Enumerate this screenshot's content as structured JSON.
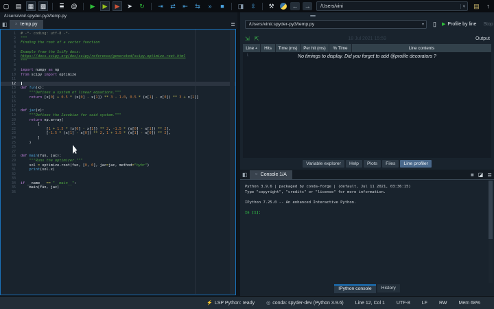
{
  "colors": {
    "accent_blue": "#1a72bb",
    "run_green": "#2fbf3a",
    "debug_blue": "#4aa3e0",
    "selected_tab_blue": "#49688b",
    "editor_bg": "#19232d",
    "string_green": "#4fa63f",
    "keyword_magenta": "#bd7fd8"
  },
  "toolbar": {
    "main_icons": [
      {
        "name": "new-file-icon",
        "glyph": "▢",
        "color": "#e8edf2"
      },
      {
        "name": "open-file-icon",
        "glyph": "▤",
        "color": "#e8edf2"
      },
      {
        "name": "save-file-icon",
        "glyph": "▦",
        "color": "#e8edf2",
        "boxed": true
      },
      {
        "name": "save-all-icon",
        "glyph": "▩",
        "color": "#e8edf2",
        "boxed": true
      },
      {
        "sep": true
      },
      {
        "name": "file-switcher-icon",
        "glyph": "≣",
        "color": "#e8edf2"
      },
      {
        "name": "find-symbols-icon",
        "glyph": "@",
        "color": "#e8edf2"
      },
      {
        "sep": true
      },
      {
        "name": "run-file-icon",
        "glyph": "▶",
        "color": "#2fbf3a"
      },
      {
        "name": "run-cell-icon",
        "glyph": "▶",
        "color": "#9ac31c",
        "boxed": true
      },
      {
        "name": "run-cell-advance-icon",
        "glyph": "▶",
        "color": "#d05438",
        "boxed": true
      },
      {
        "name": "run-selection-icon",
        "glyph": "➤",
        "color": "#dfe6ec"
      },
      {
        "name": "rerun-cell-icon",
        "glyph": "↻",
        "color": "#2fbf3a"
      },
      {
        "sep": true
      },
      {
        "name": "debug-file-icon",
        "glyph": "⇥",
        "color": "#4aa3e0"
      },
      {
        "name": "step-over-icon",
        "glyph": "⇄",
        "color": "#4aa3e0"
      },
      {
        "name": "step-into-icon",
        "glyph": "⇤",
        "color": "#4aa3e0"
      },
      {
        "name": "step-return-icon",
        "glyph": "⇆",
        "color": "#4aa3e0"
      },
      {
        "name": "continue-icon",
        "glyph": "»",
        "color": "#4aa3e0"
      },
      {
        "name": "stop-debug-icon",
        "glyph": "■",
        "color": "#4aa3e0"
      },
      {
        "sep": true
      },
      {
        "name": "panes-icon",
        "glyph": "◨",
        "color": "#8496a8"
      },
      {
        "name": "fullscreen-icon",
        "glyph": "⇳",
        "color": "#4aa3e0"
      }
    ],
    "back_glyph": "←",
    "forward_glyph": "→",
    "wrench_glyph": "⚒",
    "cwd_value": "/Users/vini",
    "open_dir_glyph": "▤",
    "parent_dir_glyph": "↑"
  },
  "editor": {
    "breadcrumb": "/Users/vini/.spyder-py3/temp.py",
    "tab_label": "temp.py",
    "close_glyph": "×",
    "options_glyph": "≣",
    "browse_tabs_glyph": "◧",
    "current_line": 12,
    "lines": [
      [
        [
          "c",
          "# -*- coding: utf-8 -*-"
        ]
      ],
      [
        [
          "s",
          "\"\"\""
        ]
      ],
      [
        [
          "s",
          "Finding the root of a vector function"
        ]
      ],
      [],
      [
        [
          "s",
          "Example from the SciPy docs:"
        ]
      ],
      [
        [
          "u",
          "https://docs.scipy.org/doc/scipy/reference/generated/scipy.optimize.root.html"
        ]
      ],
      [
        [
          "s",
          "\"\"\""
        ]
      ],
      [],
      [
        [
          "k",
          "import"
        ],
        [
          "t",
          " numpy "
        ],
        [
          "k",
          "as"
        ],
        [
          "t",
          " np"
        ]
      ],
      [
        [
          "k",
          "from"
        ],
        [
          "t",
          " scipy "
        ],
        [
          "k",
          "import"
        ],
        [
          "t",
          " optimize"
        ]
      ],
      [],
      [],
      [
        [
          "k",
          "def"
        ],
        [
          "t",
          " "
        ],
        [
          "f",
          "fun"
        ],
        [
          "t",
          "(x):"
        ]
      ],
      [
        [
          "s",
          "    \"\"\"Defines a system of linear equations.\"\"\""
        ]
      ],
      [
        [
          "k",
          "    return"
        ],
        [
          "t",
          " [x["
        ],
        [
          "n",
          "0"
        ],
        [
          "t",
          "] "
        ],
        [
          "o",
          "+"
        ],
        [
          "t",
          " "
        ],
        [
          "n",
          "0.5"
        ],
        [
          "t",
          " "
        ],
        [
          "o",
          "*"
        ],
        [
          "t",
          " (x["
        ],
        [
          "n",
          "0"
        ],
        [
          "t",
          "] "
        ],
        [
          "o",
          "-"
        ],
        [
          "t",
          " x["
        ],
        [
          "n",
          "1"
        ],
        [
          "t",
          "]) "
        ],
        [
          "o",
          "**"
        ],
        [
          "t",
          " "
        ],
        [
          "n",
          "3"
        ],
        [
          "t",
          " "
        ],
        [
          "o",
          "-"
        ],
        [
          "t",
          " "
        ],
        [
          "n",
          "1.0"
        ],
        [
          "t",
          ", "
        ],
        [
          "n",
          "0.5"
        ],
        [
          "t",
          " "
        ],
        [
          "o",
          "*"
        ],
        [
          "t",
          " (x["
        ],
        [
          "n",
          "1"
        ],
        [
          "t",
          "] "
        ],
        [
          "o",
          "-"
        ],
        [
          "t",
          " x["
        ],
        [
          "n",
          "0"
        ],
        [
          "t",
          "]) "
        ],
        [
          "o",
          "**"
        ],
        [
          "t",
          " "
        ],
        [
          "n",
          "3"
        ],
        [
          "t",
          " "
        ],
        [
          "o",
          "+"
        ],
        [
          "t",
          " x["
        ],
        [
          "n",
          "1"
        ],
        [
          "t",
          "]]"
        ]
      ],
      [],
      [],
      [
        [
          "k",
          "def"
        ],
        [
          "t",
          " "
        ],
        [
          "f",
          "jac"
        ],
        [
          "t",
          "(x):"
        ]
      ],
      [
        [
          "s",
          "    \"\"\"Defines the Jacobian for said system.\"\"\""
        ]
      ],
      [
        [
          "k",
          "    return"
        ],
        [
          "t",
          " np.array("
        ]
      ],
      [
        [
          "t",
          "        ["
        ]
      ],
      [
        [
          "t",
          "            ["
        ],
        [
          "n",
          "1"
        ],
        [
          "t",
          " "
        ],
        [
          "o",
          "+"
        ],
        [
          "t",
          " "
        ],
        [
          "n",
          "1.5"
        ],
        [
          "t",
          " "
        ],
        [
          "o",
          "*"
        ],
        [
          "t",
          " (x["
        ],
        [
          "n",
          "0"
        ],
        [
          "t",
          "] "
        ],
        [
          "o",
          "-"
        ],
        [
          "t",
          " x["
        ],
        [
          "n",
          "1"
        ],
        [
          "t",
          "]) "
        ],
        [
          "o",
          "**"
        ],
        [
          "t",
          " "
        ],
        [
          "n",
          "2"
        ],
        [
          "t",
          ", "
        ],
        [
          "o",
          "-"
        ],
        [
          "n",
          "1.5"
        ],
        [
          "t",
          " "
        ],
        [
          "o",
          "*"
        ],
        [
          "t",
          " (x["
        ],
        [
          "n",
          "0"
        ],
        [
          "t",
          "] "
        ],
        [
          "o",
          "-"
        ],
        [
          "t",
          " x["
        ],
        [
          "n",
          "1"
        ],
        [
          "t",
          "]) "
        ],
        [
          "o",
          "**"
        ],
        [
          "t",
          " "
        ],
        [
          "n",
          "2"
        ],
        [
          "t",
          "],"
        ]
      ],
      [
        [
          "t",
          "            ["
        ],
        [
          "o",
          "-"
        ],
        [
          "n",
          "1.5"
        ],
        [
          "t",
          " "
        ],
        [
          "o",
          "*"
        ],
        [
          "t",
          " (x["
        ],
        [
          "n",
          "1"
        ],
        [
          "t",
          "] "
        ],
        [
          "o",
          "-"
        ],
        [
          "t",
          " x["
        ],
        [
          "n",
          "0"
        ],
        [
          "t",
          "]) "
        ],
        [
          "o",
          "**"
        ],
        [
          "t",
          " "
        ],
        [
          "n",
          "2"
        ],
        [
          "t",
          ", "
        ],
        [
          "n",
          "1"
        ],
        [
          "t",
          " "
        ],
        [
          "o",
          "+"
        ],
        [
          "t",
          " "
        ],
        [
          "n",
          "1.5"
        ],
        [
          "t",
          " "
        ],
        [
          "o",
          "*"
        ],
        [
          "t",
          " (x["
        ],
        [
          "n",
          "1"
        ],
        [
          "t",
          "] "
        ],
        [
          "o",
          "-"
        ],
        [
          "t",
          " x["
        ],
        [
          "n",
          "0"
        ],
        [
          "t",
          "]) "
        ],
        [
          "o",
          "**"
        ],
        [
          "t",
          " "
        ],
        [
          "n",
          "2"
        ],
        [
          "t",
          "],"
        ]
      ],
      [
        [
          "t",
          "        ]"
        ]
      ],
      [
        [
          "t",
          "    )"
        ]
      ],
      [],
      [],
      [
        [
          "k",
          "def"
        ],
        [
          "t",
          " "
        ],
        [
          "f",
          "main"
        ],
        [
          "t",
          "(fun, jac):"
        ]
      ],
      [
        [
          "s",
          "    \"\"\"Runs the optimizer.\"\"\""
        ]
      ],
      [
        [
          "t",
          "    sol "
        ],
        [
          "o",
          "="
        ],
        [
          "t",
          " optimize.root(fun, ["
        ],
        [
          "n",
          "0"
        ],
        [
          "t",
          ", "
        ],
        [
          "n",
          "0"
        ],
        [
          "t",
          "], jac"
        ],
        [
          "o",
          "="
        ],
        [
          "t",
          "jac, method"
        ],
        [
          "o",
          "="
        ],
        [
          "s",
          "\"hybr\""
        ],
        [
          "t",
          ")"
        ]
      ],
      [
        [
          "t",
          "    "
        ],
        [
          "f",
          "print"
        ],
        [
          "t",
          "(sol.x)"
        ]
      ],
      [],
      [],
      [
        [
          "k",
          "if"
        ],
        [
          "t",
          " __name__ "
        ],
        [
          "o",
          "=="
        ],
        [
          "t",
          " "
        ],
        [
          "s",
          "\"__main__\""
        ],
        [
          "t",
          ":"
        ]
      ],
      [
        [
          "t",
          "    main(fun, jac)"
        ]
      ],
      []
    ]
  },
  "profiler": {
    "file_value": "/Users/vini/.spyder-py3/temp.py",
    "doc_glyph": "▯",
    "play_glyph": "▶",
    "profile_button": "Profile by line",
    "stop_button": "Stop",
    "collapse_glyph": "⇲",
    "expand_glyph": "⇱",
    "timestamp": "18 Jul 2021 15:59",
    "output_label": "Output",
    "sort_glyph": "▴",
    "columns": [
      "Line",
      "Hits",
      "Time (ms)",
      "Per hit (ms)",
      "% Time",
      "Line contents"
    ],
    "expand_mark": "└",
    "empty_message": "No timings to display. Did you forget to add @profile decorators ?"
  },
  "panel_tabs": {
    "items": [
      "Variable explorer",
      "Help",
      "Plots",
      "Files",
      "Line profiler"
    ],
    "selected": "Line profiler"
  },
  "console": {
    "browse_tabs_glyph": "◧",
    "close_glyph": "×",
    "tab_label": "Console 1/A",
    "stop_glyph": "■",
    "eraser_glyph": "◪",
    "options_glyph": "≣",
    "banner": [
      "Python 3.9.6 | packaged by conda-forge | (default, Jul 11 2021, 03:36:15)",
      "Type \"copyright\", \"credits\" or \"license\" for more information.",
      "",
      "IPython 7.25.0 -- An enhanced Interactive Python.",
      ""
    ],
    "prompt": "In [1]:"
  },
  "bottom_tabs": {
    "items": [
      "IPython console",
      "History"
    ],
    "selected": "IPython console"
  },
  "statusbar": {
    "items": [
      {
        "name": "lsp-status",
        "icon": "⚡",
        "label": "LSP Python: ready"
      },
      {
        "name": "interpreter-status",
        "icon": "◎",
        "label": "conda: spyder-dev (Python 3.9.6)"
      },
      {
        "name": "cursor-position",
        "icon": "",
        "label": "Line 12, Col 1"
      },
      {
        "name": "encoding-status",
        "icon": "",
        "label": "UTF-8"
      },
      {
        "name": "eol-status",
        "icon": "",
        "label": "LF"
      },
      {
        "name": "readwrite-status",
        "icon": "",
        "label": "RW"
      },
      {
        "name": "memory-status",
        "icon": "",
        "label": "Mem 68%"
      }
    ]
  }
}
